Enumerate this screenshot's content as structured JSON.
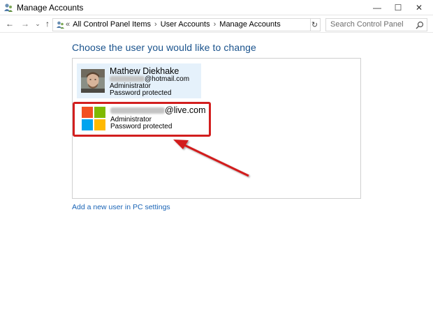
{
  "window": {
    "title": "Manage Accounts",
    "minimize_glyph": "—",
    "maximize_glyph": "☐",
    "close_glyph": "✕"
  },
  "nav": {
    "back_glyph": "←",
    "forward_glyph": "→",
    "recent_glyph": "⌄",
    "up_glyph": "↑",
    "chevron": "«",
    "separator": "›",
    "breadcrumbs": [
      "All Control Panel Items",
      "User Accounts",
      "Manage Accounts"
    ],
    "dropdown_glyph": "⌄",
    "refresh_glyph": "↻"
  },
  "search": {
    "placeholder": "Search Control Panel",
    "icon": "search-icon"
  },
  "main": {
    "heading": "Choose the user you would like to change",
    "accounts": [
      {
        "name": "Mathew Diekhake",
        "email_suffix": "@hotmail.com",
        "role": "Administrator",
        "status": "Password protected",
        "avatar": "user-photo"
      },
      {
        "name_suffix": "@live.com",
        "role": "Administrator",
        "status": "Password protected",
        "avatar": "microsoft-logo-icon",
        "logo_colors": [
          "#f25022",
          "#7fba00",
          "#00a4ef",
          "#ffb900"
        ]
      }
    ],
    "add_user_link": "Add a new user in PC settings"
  },
  "colors": {
    "heading": "#19528c",
    "link": "#1a64b6",
    "selected_bg": "#e5f1fb",
    "highlight": "#d21e1e"
  }
}
